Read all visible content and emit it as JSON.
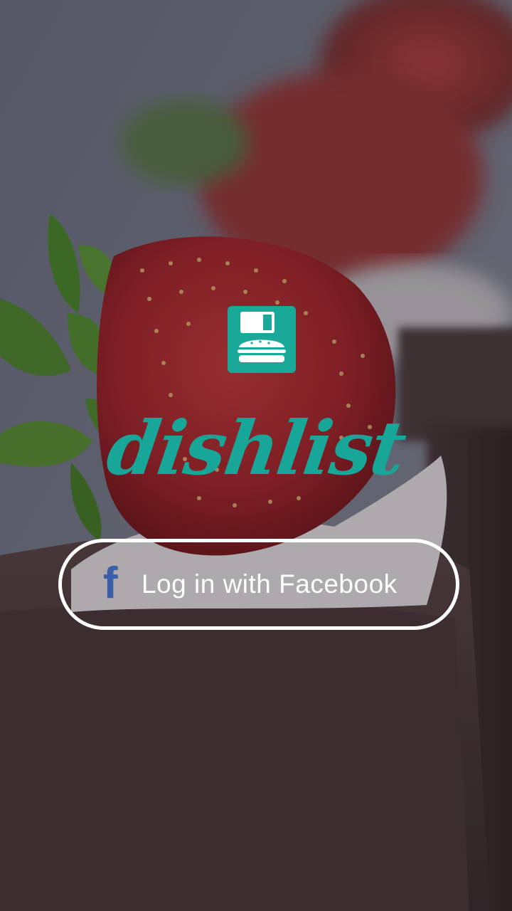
{
  "app": {
    "brand_name": "dishlist",
    "logo_icon": "burger-save-icon"
  },
  "login": {
    "facebook_label": "Log in with Facebook",
    "facebook_icon": "facebook-icon",
    "facebook_glyph": "f"
  },
  "colors": {
    "brand_teal": "#1aa898",
    "facebook_blue": "#3a5ea8",
    "button_border": "#ffffff"
  }
}
